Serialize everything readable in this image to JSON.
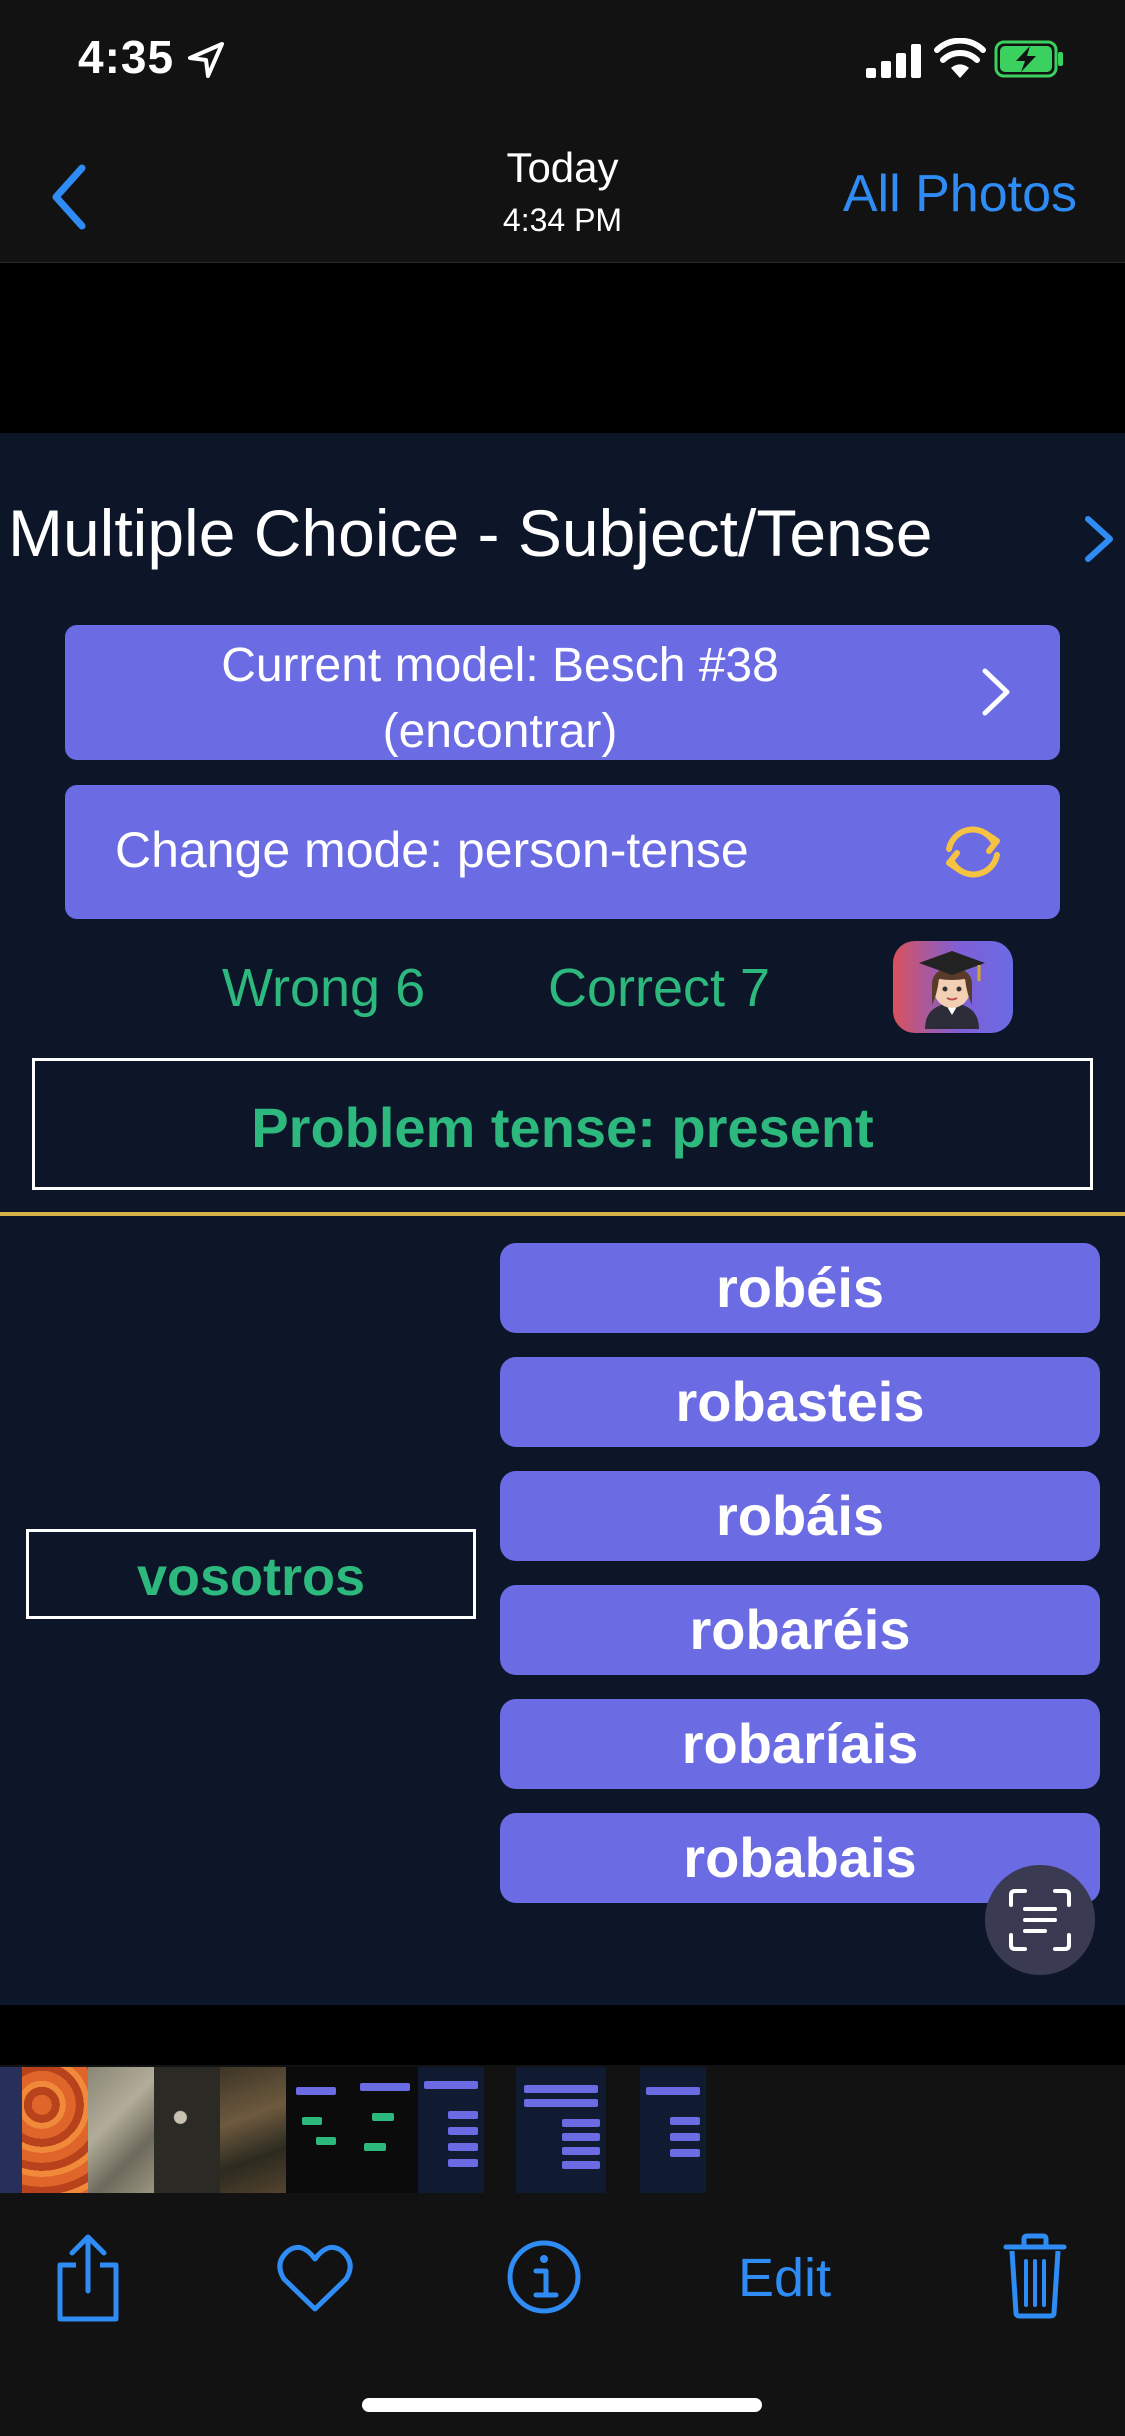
{
  "status_bar": {
    "time": "4:35"
  },
  "nav": {
    "title": "Today",
    "subtitle": "4:34 PM",
    "right_label": "All Photos",
    "accent_color": "#2f8cf5"
  },
  "app": {
    "title": "Multiple Choice - Subject/Tense",
    "model_button": {
      "line1": "Current model: Besch #38",
      "line2": "(encontrar)"
    },
    "mode_button": "Change mode: person-tense",
    "score": {
      "wrong": "Wrong 6",
      "correct": "Correct 7"
    },
    "problem": "Problem tense: present",
    "subject": "vosotros",
    "answers": [
      "robéis",
      "robasteis",
      "robáis",
      "robaréis",
      "robaríais",
      "robabais"
    ],
    "colors": {
      "button": "#6b6be4",
      "text_green": "#2db87d",
      "background": "#0d1628",
      "divider": "#d8b04a"
    }
  },
  "toolbar": {
    "edit_label": "Edit"
  },
  "icons": [
    "location-arrow-icon",
    "signal-icon",
    "wifi-icon",
    "battery-charging-icon",
    "back-chevron-icon",
    "chevron-right-icon",
    "refresh-icon",
    "student-avatar-icon",
    "live-text-icon",
    "share-icon",
    "heart-icon",
    "info-icon",
    "trash-icon"
  ]
}
